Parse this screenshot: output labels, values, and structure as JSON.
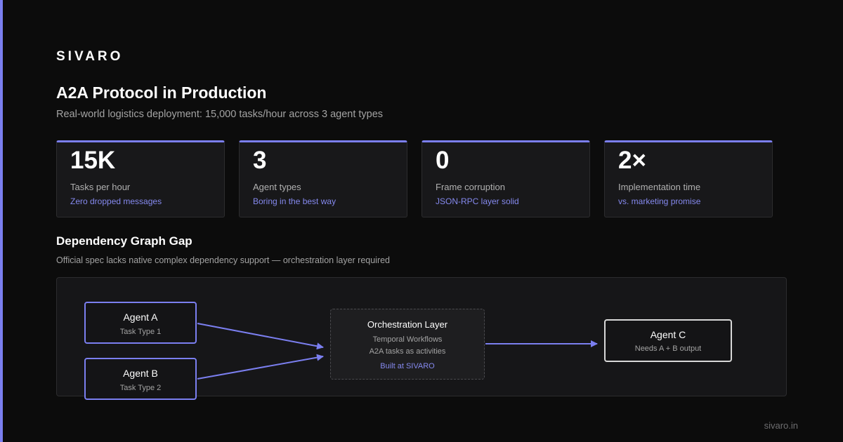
{
  "brand": "SIVARO",
  "title": "A2A Protocol in Production",
  "subtitle": "Real-world logistics deployment: 15,000 tasks/hour across 3 agent types",
  "colors": {
    "accent": "#7b7ff0",
    "background": "#0c0c0c",
    "card": "#18181a"
  },
  "stats": [
    {
      "value": "15K",
      "label": "Tasks per hour",
      "note": "Zero dropped messages"
    },
    {
      "value": "3",
      "label": "Agent types",
      "note": "Boring in the best way"
    },
    {
      "value": "0",
      "label": "Frame corruption",
      "note": "JSON-RPC layer solid"
    },
    {
      "value": "2×",
      "label": "Implementation time",
      "note": "vs. marketing promise"
    }
  ],
  "section": {
    "title": "Dependency Graph Gap",
    "subtitle": "Official spec lacks native complex dependency support — orchestration layer required"
  },
  "diagram": {
    "agent_a": {
      "title": "Agent A",
      "sub": "Task Type 1"
    },
    "agent_b": {
      "title": "Agent B",
      "sub": "Task Type 2"
    },
    "orchestration": {
      "title": "Orchestration Layer",
      "line1": "Temporal Workflows",
      "line2": "A2A tasks as activities",
      "built": "Built at SIVARO"
    },
    "agent_c": {
      "title": "Agent C",
      "sub": "Needs A + B output"
    }
  },
  "footer": {
    "url": "sivaro.in"
  }
}
